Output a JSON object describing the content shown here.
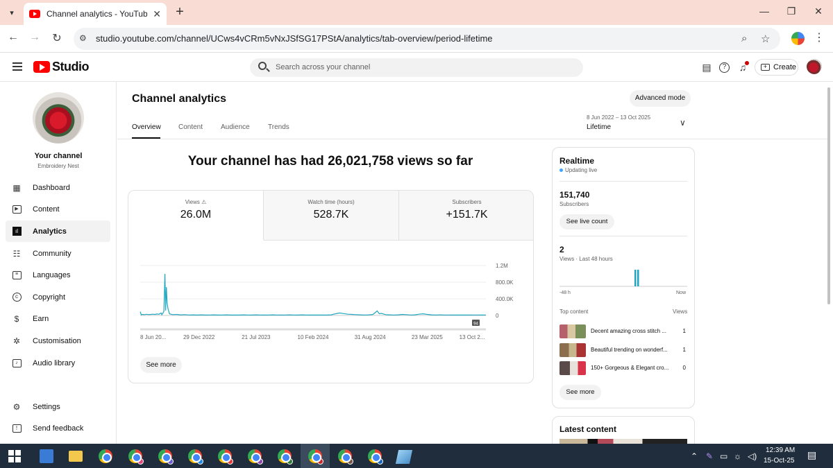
{
  "browser": {
    "tab_title": "Channel analytics - YouTube Studio",
    "url": "studio.youtube.com/channel/UCws4vCRm5vNxJSfSG17PStA/analytics/tab-overview/period-lifetime"
  },
  "header": {
    "logo_text": "Studio",
    "search_placeholder": "Search across your channel",
    "create_label": "Create"
  },
  "sidebar": {
    "your_channel": "Your channel",
    "channel_name": "Embroidery Nest",
    "items": [
      {
        "label": "Dashboard",
        "icon": "dashboard-icon"
      },
      {
        "label": "Content",
        "icon": "content-icon"
      },
      {
        "label": "Analytics",
        "icon": "analytics-icon",
        "active": true
      },
      {
        "label": "Community",
        "icon": "community-icon"
      },
      {
        "label": "Languages",
        "icon": "languages-icon"
      },
      {
        "label": "Copyright",
        "icon": "copyright-icon"
      },
      {
        "label": "Earn",
        "icon": "earn-icon"
      },
      {
        "label": "Customisation",
        "icon": "customisation-icon"
      },
      {
        "label": "Audio library",
        "icon": "audio-library-icon"
      }
    ],
    "bottom_items": [
      {
        "label": "Settings",
        "icon": "settings-icon"
      },
      {
        "label": "Send feedback",
        "icon": "feedback-icon"
      }
    ]
  },
  "main": {
    "title": "Channel analytics",
    "advanced_mode": "Advanced mode",
    "tabs": [
      "Overview",
      "Content",
      "Audience",
      "Trends"
    ],
    "period_range": "8 Jun 2022 – 13 Oct 2025",
    "period_label": "Lifetime",
    "headline": "Your channel has had 26,021,758 views so far",
    "metrics": [
      {
        "label": "Views",
        "value": "26.0M"
      },
      {
        "label": "Watch time (hours)",
        "value": "528.7K"
      },
      {
        "label": "Subscribers",
        "value": "+151.7K"
      }
    ],
    "see_more": "See more",
    "chart_badge": "94"
  },
  "chart_data": {
    "type": "line",
    "series_color": "#1fa6c0",
    "x_ticks": [
      "8 Jun 20...",
      "29 Dec 2022",
      "21 Jul 2023",
      "10 Feb 2024",
      "31 Aug 2024",
      "23 Mar 2025",
      "13 Oct 2..."
    ],
    "y_ticks": [
      "1.2M",
      "800.0K",
      "400.0K",
      "0"
    ],
    "ylim": [
      0,
      1200000
    ],
    "points": [
      [
        0,
        90000
      ],
      [
        1.5,
        15000
      ],
      [
        3,
        25000
      ],
      [
        6,
        20000
      ],
      [
        9,
        28000
      ],
      [
        12,
        22000
      ],
      [
        15,
        25000
      ],
      [
        18,
        30000
      ],
      [
        21,
        25000
      ],
      [
        24,
        35000
      ],
      [
        27,
        30000
      ],
      [
        30,
        60000
      ],
      [
        31,
        20000
      ],
      [
        32,
        40000
      ],
      [
        34,
        100000
      ],
      [
        35.5,
        1000000
      ],
      [
        36.5,
        120000
      ],
      [
        37.5,
        680000
      ],
      [
        38.5,
        300000
      ],
      [
        40,
        150000
      ],
      [
        42,
        40000
      ],
      [
        46,
        20000
      ],
      [
        52,
        25000
      ],
      [
        58,
        15000
      ],
      [
        64,
        20000
      ],
      [
        70,
        12000
      ],
      [
        76,
        15000
      ],
      [
        82,
        10000
      ],
      [
        88,
        15000
      ],
      [
        94,
        10000
      ],
      [
        100,
        12000
      ],
      [
        106,
        15000
      ],
      [
        112,
        10000
      ],
      [
        118,
        12000
      ],
      [
        124,
        15000
      ],
      [
        130,
        10000
      ],
      [
        136,
        12000
      ],
      [
        142,
        10000
      ],
      [
        148,
        15000
      ],
      [
        154,
        12000
      ],
      [
        160,
        10000
      ],
      [
        166,
        15000
      ],
      [
        172,
        12000
      ],
      [
        178,
        10000
      ],
      [
        184,
        12000
      ],
      [
        190,
        15000
      ],
      [
        196,
        12000
      ],
      [
        202,
        10000
      ],
      [
        208,
        12000
      ],
      [
        214,
        15000
      ],
      [
        220,
        12000
      ],
      [
        226,
        10000
      ],
      [
        232,
        15000
      ],
      [
        238,
        12000
      ],
      [
        244,
        10000
      ],
      [
        250,
        12000
      ],
      [
        256,
        10000
      ],
      [
        262,
        12000
      ],
      [
        268,
        10000
      ],
      [
        274,
        15000
      ],
      [
        280,
        40000
      ],
      [
        286,
        60000
      ],
      [
        292,
        45000
      ],
      [
        298,
        30000
      ],
      [
        304,
        25000
      ],
      [
        310,
        20000
      ],
      [
        316,
        15000
      ],
      [
        322,
        12000
      ],
      [
        328,
        15000
      ],
      [
        334,
        25000
      ],
      [
        340,
        110000
      ],
      [
        343,
        40000
      ],
      [
        346,
        50000
      ],
      [
        352,
        20000
      ],
      [
        358,
        15000
      ],
      [
        364,
        12000
      ],
      [
        370,
        15000
      ],
      [
        376,
        25000
      ],
      [
        382,
        20000
      ],
      [
        388,
        12000
      ],
      [
        394,
        15000
      ],
      [
        400,
        30000
      ],
      [
        406,
        40000
      ],
      [
        412,
        25000
      ],
      [
        418,
        15000
      ],
      [
        424,
        12000
      ],
      [
        430,
        15000
      ],
      [
        436,
        12000
      ],
      [
        442,
        12000
      ],
      [
        448,
        10000
      ],
      [
        454,
        12000
      ],
      [
        460,
        10000
      ],
      [
        466,
        12000
      ],
      [
        472,
        10000
      ],
      [
        478,
        12000
      ],
      [
        484,
        12000
      ],
      [
        490,
        10000
      ],
      [
        496,
        12000
      ]
    ],
    "x_range": [
      0,
      496
    ]
  },
  "realtime": {
    "title": "Realtime",
    "live": "Updating live",
    "subscribers_value": "151,740",
    "subscribers_label": "Subscribers",
    "see_live_count": "See live count",
    "views_value": "2",
    "views_label": "Views · Last 48 hours",
    "axis_left": "-48 h",
    "axis_right": "Now",
    "bars_values": [
      1,
      1
    ],
    "top_content": "Top content",
    "views_col": "Views",
    "rows": [
      {
        "title": "Decent amazing cross stitch ...",
        "value": "1"
      },
      {
        "title": "Beautiful trending on wonderf...",
        "value": "1"
      },
      {
        "title": "150+ Gorgeous & Elegant cro...",
        "value": "0"
      }
    ],
    "see_more": "See more"
  },
  "latest": {
    "title": "Latest content"
  },
  "taskbar": {
    "time": "12:39 AM",
    "date": "15-Oct-25"
  }
}
